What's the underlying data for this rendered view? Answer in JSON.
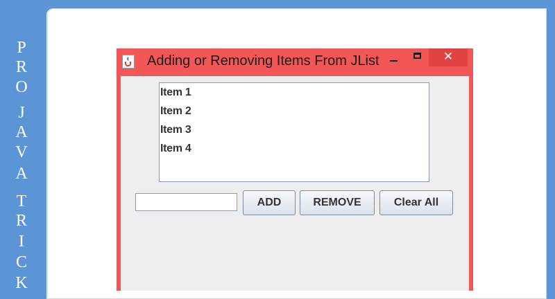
{
  "brand": {
    "letters": [
      "P",
      "R",
      "O",
      "J",
      "A",
      "V",
      "A",
      "T",
      "R",
      "I",
      "C",
      "K"
    ]
  },
  "window": {
    "title": "Adding or Removing Items From JList",
    "close_glyph": "✕"
  },
  "list": {
    "items": [
      "Item 1",
      "Item 2",
      "Item 3",
      "Item 4"
    ]
  },
  "input": {
    "value": ""
  },
  "buttons": {
    "add_label": "ADD",
    "remove_label": "REMOVE",
    "clear_label": "Clear All"
  },
  "colors": {
    "window_frame": "#f25757",
    "close_button": "#e04343",
    "page_background": "#5b95d6"
  }
}
